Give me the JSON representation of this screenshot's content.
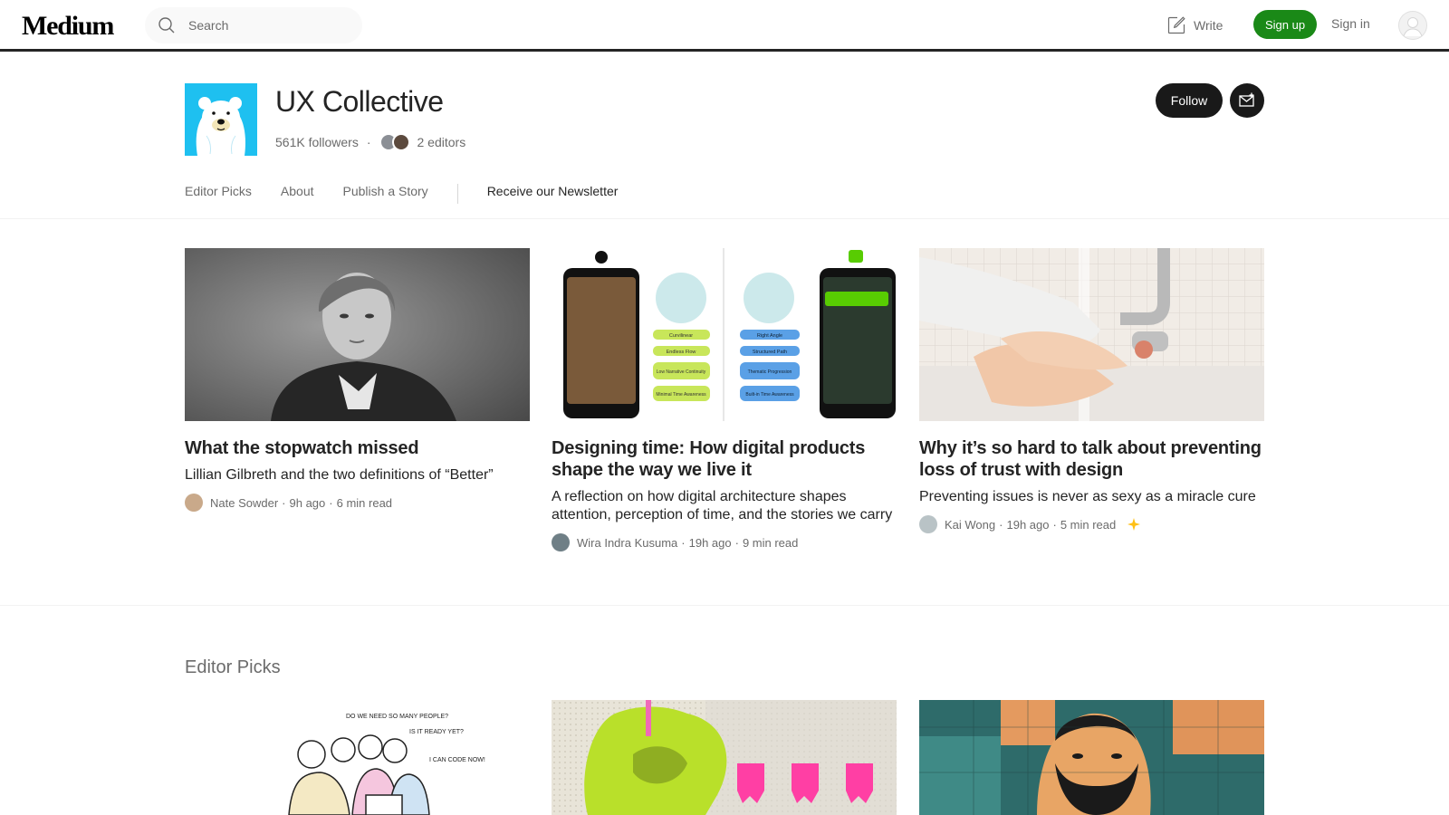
{
  "header": {
    "logo": "Medium",
    "search_placeholder": "Search",
    "write_label": "Write",
    "signup_label": "Sign up",
    "signin_label": "Sign in"
  },
  "publication": {
    "name": "UX Collective",
    "followers": "561K followers",
    "separator": "·",
    "editors": "2 editors",
    "follow_label": "Follow"
  },
  "tabs": [
    {
      "label": "Editor Picks",
      "active": false
    },
    {
      "label": "About",
      "active": false
    },
    {
      "label": "Publish a Story",
      "active": false
    },
    {
      "label": "Receive our Newsletter",
      "active": true
    }
  ],
  "stories": [
    {
      "title": "What the stopwatch missed",
      "subtitle": "Lillian Gilbreth and the two definitions of “Better”",
      "author": "Nate Sowder",
      "time": "9h ago",
      "read": "6 min read",
      "member_only": false
    },
    {
      "title": "Designing time: How digital products shape the way we live it",
      "subtitle": "A reflection on how digital architecture shapes attention, perception of time, and the stories we carry",
      "author": "Wira Indra Kusuma",
      "time": "19h ago",
      "read": "9 min read",
      "member_only": false
    },
    {
      "title": "Why it’s so hard to talk about preventing loss of trust with design",
      "subtitle": "Preventing issues is never as sexy as a miracle cure",
      "author": "Kai Wong",
      "time": "19h ago",
      "read": "5 min read",
      "member_only": true
    }
  ],
  "story_image_text": {
    "sketch_lines": [
      "Curvilinear",
      "Endless Flow",
      "Low Narrative Continuity",
      "Minimal Time Awareness"
    ],
    "sketch_lines_right": [
      "Right Angle",
      "Structured Path",
      "Thematic Progression",
      "Built-in Time Awareness"
    ]
  },
  "editor_picks": {
    "title": "Editor Picks",
    "cartoon_text": [
      "DO WE NEED SO MANY PEOPLE?",
      "IS IT READY YET?",
      "I CAN CODE NOW!"
    ]
  },
  "colors": {
    "accent_green": "#1a8917",
    "text": "#242424",
    "muted": "#6b6b6b",
    "pub_logo_bg": "#1ec0f0",
    "member_star": "#ffc017"
  }
}
